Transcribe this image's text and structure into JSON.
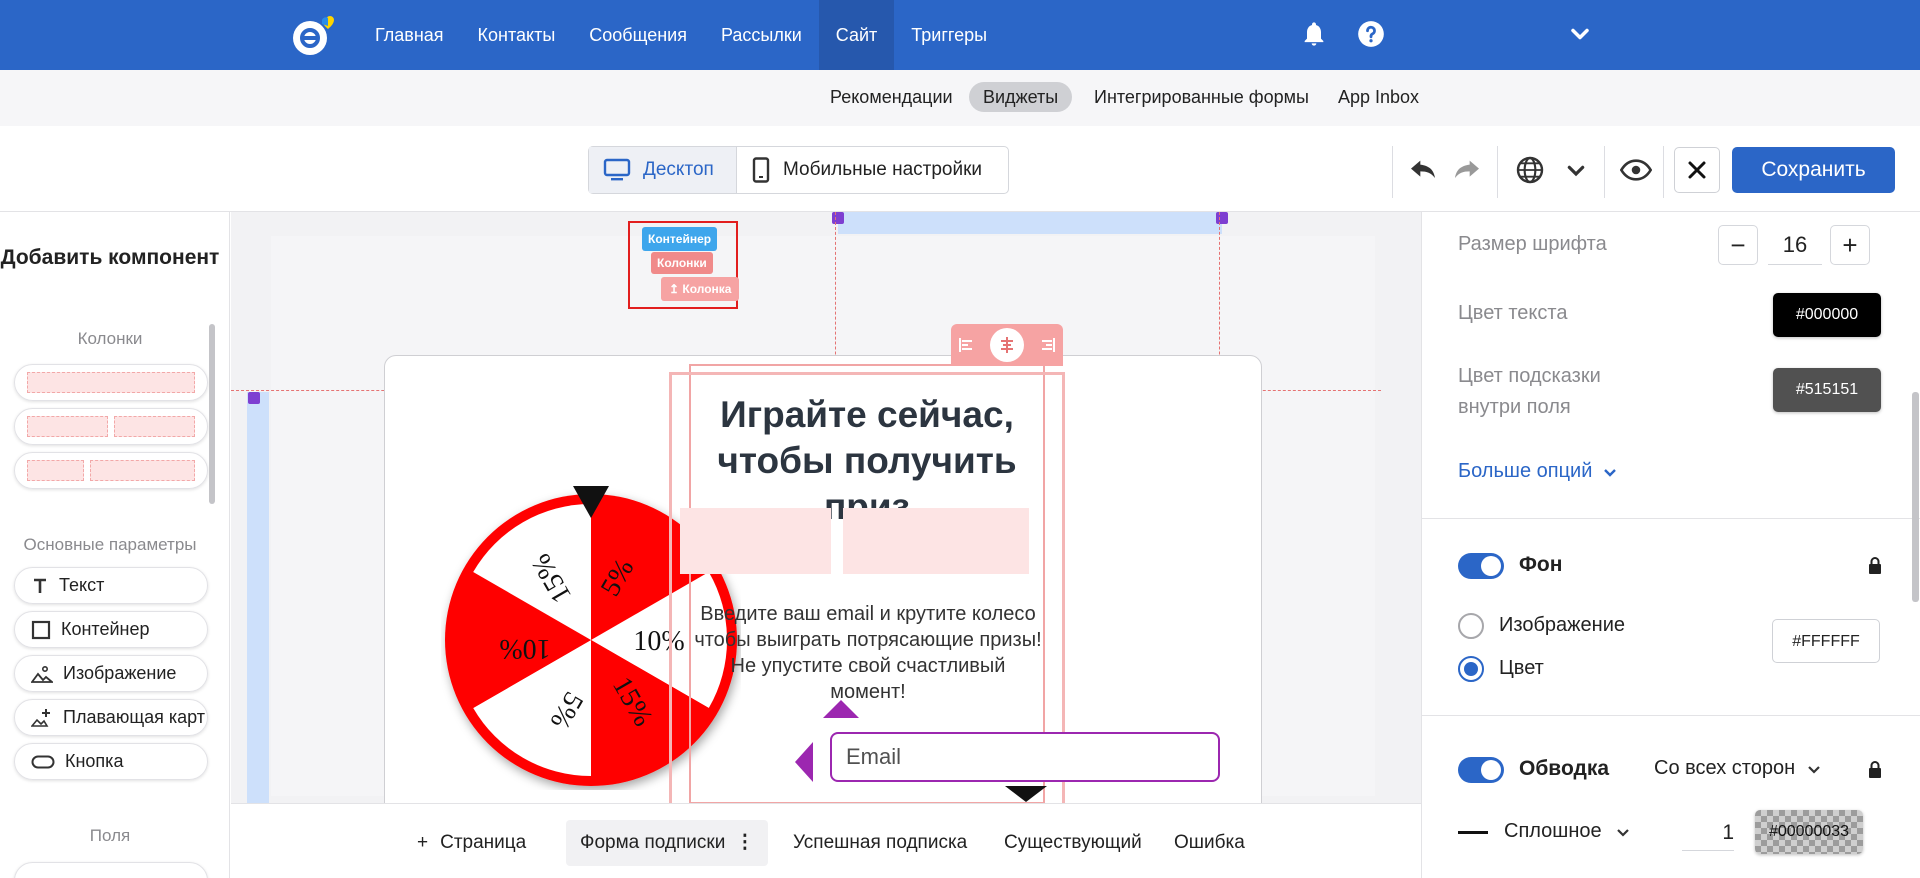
{
  "nav": {
    "items": [
      "Главная",
      "Контакты",
      "Сообщения",
      "Рассылки",
      "Сайт",
      "Триггеры"
    ],
    "active_index": 4
  },
  "subnav": {
    "items": [
      "Рекомендации",
      "Виджеты",
      "Интегрированные формы",
      "App Inbox"
    ],
    "active_index": 1
  },
  "toolbar": {
    "desktop_label": "Десктоп",
    "mobile_label": "Мобильные настройки",
    "save_label": "Сохранить"
  },
  "left_panel": {
    "title": "Добавить компонент",
    "columns_section": "Колонки",
    "basic_section": "Основные параметры",
    "components": [
      "Текст",
      "Контейнер",
      "Изображение",
      "Плавающая карт",
      "Кнопка"
    ],
    "fields_section": "Поля"
  },
  "canvas": {
    "badge_container": "Контейнер",
    "badge_column": "Колонки",
    "badge_column2": "Колонка",
    "heading_line1": "Играйте сейчас,",
    "heading_line2": "чтобы получить приз",
    "body_line1": "Введите ваш email и крутите колесо",
    "body_line2": "чтобы выиграть потрясающие призы!",
    "body_line3": "Не упустите свой счастливый",
    "body_line4": "момент!",
    "email_placeholder": "Email",
    "wheel_segments": [
      "5%",
      "10%",
      "15%",
      "5%",
      "10%",
      "15%"
    ],
    "wheel_colors": {
      "red": "#ff0000",
      "white": "#ffffff"
    }
  },
  "bottom_tabs": {
    "add_page": "Страница",
    "tabs": [
      "Форма подписки",
      "Успешная подписка",
      "Существующий",
      "Ошибка"
    ],
    "active_index": 0
  },
  "right_panel": {
    "font_size_label": "Размер шрифта",
    "font_size_value": "16",
    "text_color_label": "Цвет текста",
    "text_color_value": "#000000",
    "placeholder_color_label_1": "Цвет подсказки",
    "placeholder_color_label_2": "внутри поля",
    "placeholder_color_value": "#515151",
    "more_options": "Больше опций",
    "background_label": "Фон",
    "image_option": "Изображение",
    "color_option": "Цвет",
    "background_color_value": "#FFFFFF",
    "border_label": "Обводка",
    "border_sides": "Со всех сторон",
    "border_style": "Сплошное",
    "border_width": "1",
    "border_color_value": "#00000033"
  },
  "colors": {
    "brand": "#2b66c7",
    "accent_magenta": "#9c27b0",
    "selection_red": "#e53935"
  }
}
